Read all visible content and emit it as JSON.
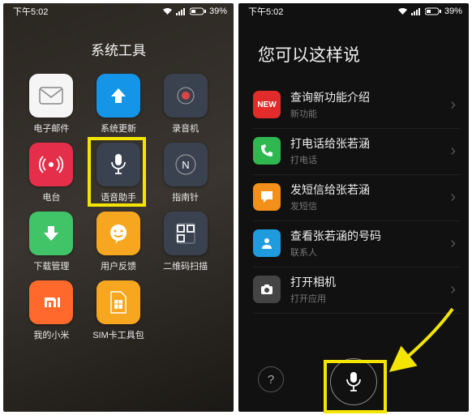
{
  "status": {
    "time": "下午5:02",
    "battery": "39%"
  },
  "left": {
    "folder_title": "系统工具",
    "apps": [
      {
        "label": "电子邮件",
        "bg": "#f5f5f5"
      },
      {
        "label": "系统更新",
        "bg": "#1495e8"
      },
      {
        "label": "录音机",
        "bg": "#3a4250"
      },
      {
        "label": "电台",
        "bg": "#e52f4a"
      },
      {
        "label": "语音助手",
        "bg": "#3a4250"
      },
      {
        "label": "指南针",
        "bg": "#3a4250"
      },
      {
        "label": "下载管理",
        "bg": "#41c367"
      },
      {
        "label": "用户反馈",
        "bg": "#f7a61f"
      },
      {
        "label": "二维码扫描",
        "bg": "#3a4250"
      },
      {
        "label": "我的小米",
        "bg": "#ff6a2c"
      },
      {
        "label": "SIM卡工具包",
        "bg": "#f7a61f"
      }
    ]
  },
  "right": {
    "title": "您可以这样说",
    "items": [
      {
        "title": "查询新功能介绍",
        "sub": "新功能",
        "bg": "#e22b2b",
        "kind": "new"
      },
      {
        "title": "打电话给张若涵",
        "sub": "打电话",
        "bg": "#2fb84f",
        "kind": "phone"
      },
      {
        "title": "发短信给张若涵",
        "sub": "发短信",
        "bg": "#f39019",
        "kind": "sms"
      },
      {
        "title": "查看张若涵的号码",
        "sub": "联系人",
        "bg": "#1f9cde",
        "kind": "contact"
      },
      {
        "title": "打开相机",
        "sub": "打开应用",
        "bg": "#444",
        "kind": "camera"
      }
    ],
    "help_label": "?",
    "new_badge": "NEW"
  }
}
